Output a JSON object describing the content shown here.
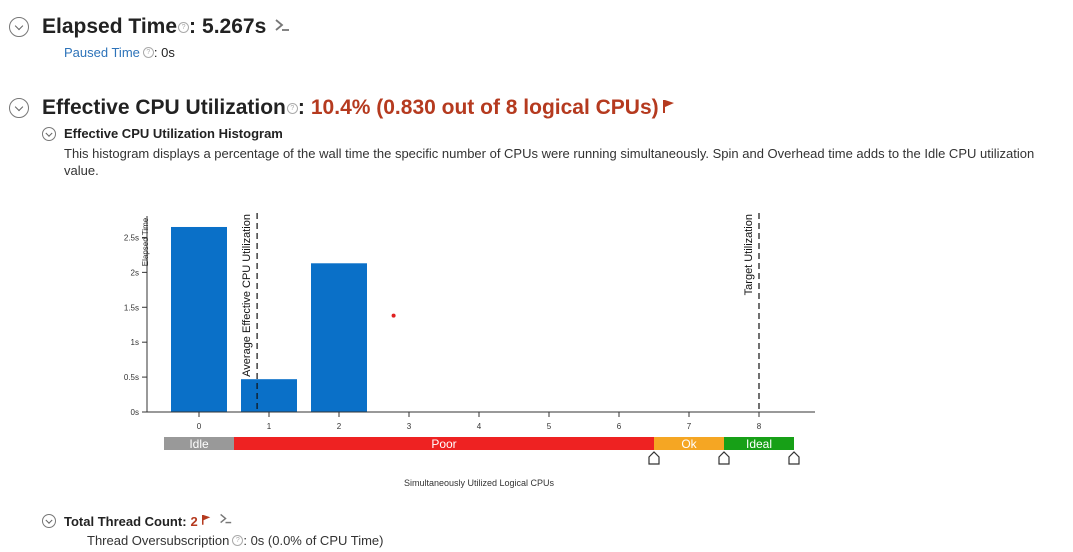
{
  "elapsed": {
    "label": "Elapsed Time",
    "colon": ":",
    "value": "5.267s"
  },
  "paused": {
    "label": "Paused Time",
    "value": ": 0s"
  },
  "effective": {
    "label": "Effective CPU Utilization",
    "colon": ":",
    "value": "10.4% (0.830 out of 8 logical CPUs)"
  },
  "histogram": {
    "title": "Effective CPU Utilization Histogram",
    "description": "This histogram displays a percentage of the wall time the specific number of CPUs were running simultaneously. Spin and Overhead time adds to the Idle CPU utilization value."
  },
  "thread": {
    "label": "Total Thread Count:",
    "value": "2",
    "oversub_label": "Thread Oversubscription",
    "oversub_value": ": 0s (0.0% of CPU Time)"
  },
  "colors": {
    "bar": "#0a70c8",
    "idle": "#999999",
    "poor": "#ee2222",
    "ok": "#f5a623",
    "ideal": "#17a017",
    "accent": "#b53a1f",
    "link": "#2d73b9"
  },
  "chart_data": {
    "type": "bar",
    "categories": [
      "0",
      "1",
      "2",
      "3",
      "4",
      "5",
      "6",
      "7",
      "8"
    ],
    "values": [
      2.65,
      0.47,
      2.13,
      0,
      0,
      0,
      0,
      0,
      0
    ],
    "ylabel": "Elapsed Time",
    "xlabel": "Simultaneously Utilized Logical CPUs",
    "yticks": [
      {
        "v": 0,
        "label": "0s"
      },
      {
        "v": 0.5,
        "label": "0.5s"
      },
      {
        "v": 1,
        "label": "1s"
      },
      {
        "v": 1.5,
        "label": "1.5s"
      },
      {
        "v": 2,
        "label": "2s"
      },
      {
        "v": 2.5,
        "label": "2.5s"
      }
    ],
    "ylim": [
      0,
      2.75
    ],
    "markers": [
      {
        "x": 0.83,
        "label": "Average Effective CPU Utilization"
      },
      {
        "x": 8,
        "label": "Target Utilization"
      }
    ],
    "red_dot": {
      "x": 2.78,
      "y": 1.38
    },
    "ranges": [
      {
        "name": "Idle",
        "from": -0.5,
        "to": 0.5,
        "color": "#999999"
      },
      {
        "name": "Poor",
        "from": 0.5,
        "to": 6.5,
        "color": "#ee2222"
      },
      {
        "name": "Ok",
        "from": 6.5,
        "to": 7.5,
        "color": "#f5a623"
      },
      {
        "name": "Ideal",
        "from": 7.5,
        "to": 8.5,
        "color": "#17a017"
      }
    ],
    "grid": false
  }
}
